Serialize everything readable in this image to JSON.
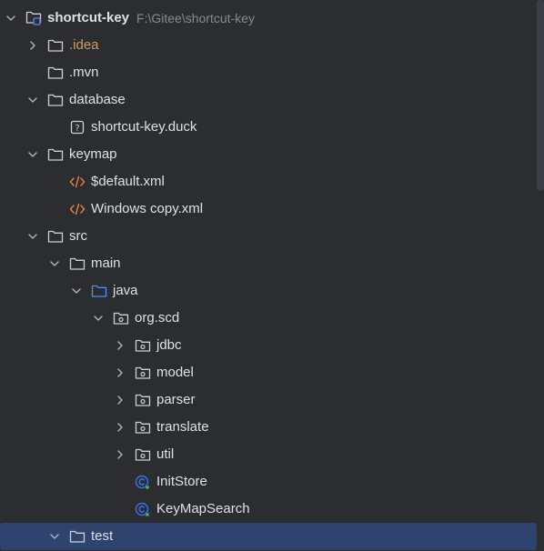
{
  "project": {
    "name": "shortcut-key",
    "path": "F:\\Gitee\\shortcut-key"
  },
  "tree": [
    {
      "label": "shortcut-key",
      "path": "F:\\Gitee\\shortcut-key",
      "depth": 0,
      "chevron": "down",
      "icon": "module-folder-icon",
      "style": "root"
    },
    {
      "label": ".idea",
      "depth": 1,
      "chevron": "right",
      "icon": "folder-icon",
      "style": "excluded"
    },
    {
      "label": ".mvn",
      "depth": 1,
      "chevron": "none",
      "icon": "folder-icon",
      "style": "normal"
    },
    {
      "label": "database",
      "depth": 1,
      "chevron": "down",
      "icon": "folder-icon",
      "style": "normal"
    },
    {
      "label": "shortcut-key.duck",
      "depth": 2,
      "chevron": "none",
      "icon": "unknown-file-icon",
      "style": "normal"
    },
    {
      "label": "keymap",
      "depth": 1,
      "chevron": "down",
      "icon": "folder-icon",
      "style": "normal"
    },
    {
      "label": "$default.xml",
      "depth": 2,
      "chevron": "none",
      "icon": "xml-file-icon",
      "style": "normal"
    },
    {
      "label": "Windows copy.xml",
      "depth": 2,
      "chevron": "none",
      "icon": "xml-file-icon",
      "style": "normal"
    },
    {
      "label": "src",
      "depth": 1,
      "chevron": "down",
      "icon": "folder-icon",
      "style": "normal"
    },
    {
      "label": "main",
      "depth": 2,
      "chevron": "down",
      "icon": "folder-icon",
      "style": "normal"
    },
    {
      "label": "java",
      "depth": 3,
      "chevron": "down",
      "icon": "source-folder-icon",
      "style": "normal"
    },
    {
      "label": "org.scd",
      "depth": 4,
      "chevron": "down",
      "icon": "package-icon",
      "style": "normal"
    },
    {
      "label": "jdbc",
      "depth": 5,
      "chevron": "right",
      "icon": "package-icon",
      "style": "normal"
    },
    {
      "label": "model",
      "depth": 5,
      "chevron": "right",
      "icon": "package-icon",
      "style": "normal"
    },
    {
      "label": "parser",
      "depth": 5,
      "chevron": "right",
      "icon": "package-icon",
      "style": "normal"
    },
    {
      "label": "translate",
      "depth": 5,
      "chevron": "right",
      "icon": "package-icon",
      "style": "normal"
    },
    {
      "label": "util",
      "depth": 5,
      "chevron": "right",
      "icon": "package-icon",
      "style": "normal"
    },
    {
      "label": "InitStore",
      "depth": 5,
      "chevron": "none",
      "icon": "java-class-icon",
      "style": "normal"
    },
    {
      "label": "KeyMapSearch",
      "depth": 5,
      "chevron": "none",
      "icon": "java-class-icon",
      "style": "normal"
    },
    {
      "label": "test",
      "depth": 2,
      "chevron": "down",
      "icon": "folder-icon",
      "style": "selected"
    }
  ],
  "colors": {
    "background": "#2b2d30",
    "selection": "#2e436e",
    "text": "#dfe1e5",
    "excluded": "#d19a66",
    "muted": "#868a91",
    "source_folder": "#548af7",
    "xml_icon": "#e07b45",
    "class_icon": "#3574f0"
  }
}
